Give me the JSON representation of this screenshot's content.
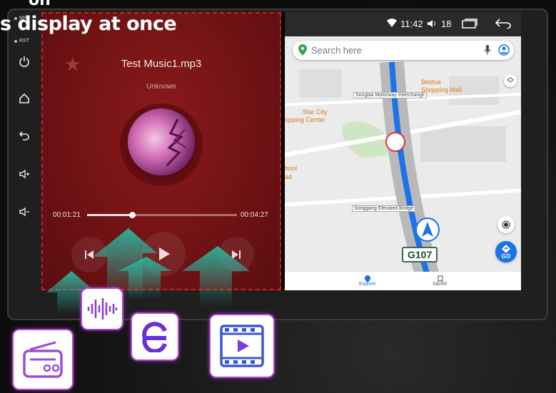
{
  "headline": {
    "text": "s display at once",
    "partial_top": "on"
  },
  "sidebar": {
    "mic_label": "MIC",
    "rst_label": "RST",
    "icons": [
      "power-icon",
      "home-icon",
      "back-icon",
      "volume-up-icon",
      "volume-down-icon"
    ]
  },
  "music": {
    "title": "Test Music1.mp3",
    "artist": "Unknown",
    "elapsed": "00:01:21",
    "total": "00:04:27",
    "progress": 0.3
  },
  "map": {
    "status": {
      "time": "11:42",
      "volume": "18"
    },
    "search_placeholder": "Search here",
    "labels": {
      "interchange": "Songbai Motorway Interchange",
      "mall": "Bestva Shopping Mall",
      "mall_line1": "Bestva",
      "mall_line2": "Shopping Mall",
      "star_city_1": "Star City",
      "star_city_2": "opping Center",
      "school_1": "hool",
      "school_2": "ad",
      "bridge": "Songgang Elevated Bridge"
    },
    "highway": "G107",
    "go_label": "GO",
    "nav": {
      "explore": "Explore",
      "saved": "Saved"
    }
  },
  "apps": [
    "radio-app-icon",
    "audio-wave-app-icon",
    "browser-app-icon",
    "video-app-icon"
  ],
  "colors": {
    "accent": "#b144d6",
    "music_bg": "#6e1214",
    "route": "#1a73e8",
    "arrow": "#2bb5a0"
  }
}
